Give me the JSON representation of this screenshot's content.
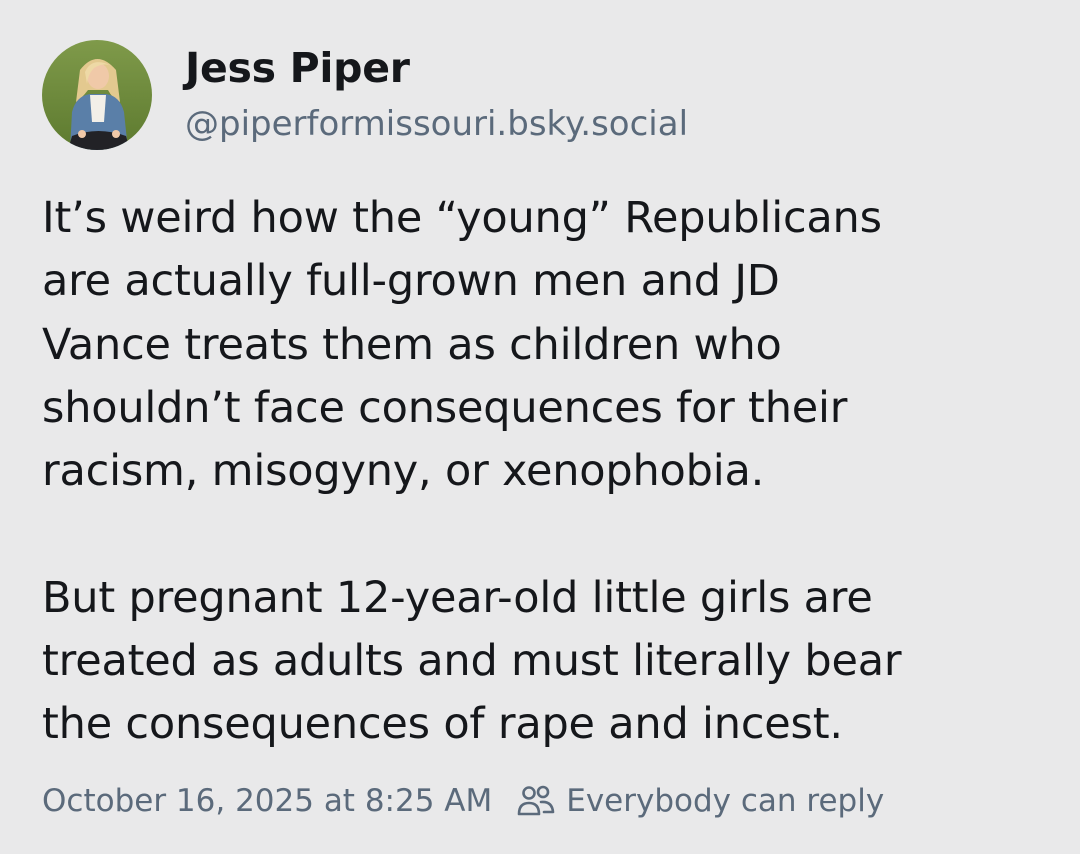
{
  "author": {
    "display_name": "Jess Piper",
    "handle": "@piperformissouri.bsky.social",
    "avatar_icon": "profile-photo"
  },
  "post": {
    "paragraphs": [
      "It’s weird how the “young” Republicans\nare actually full-grown men and JD\nVance treats them as children who\nshouldn’t face consequences for their\nracism, misogyny, or xenophobia.",
      "But pregnant 12-year-old little girls are\ntreated as adults and must literally bear\nthe consequences of rape and incest."
    ]
  },
  "meta": {
    "timestamp": "October 16, 2025 at 8:25 AM",
    "reply_icon": "people-icon",
    "reply_setting": "Everybody can reply"
  },
  "colors": {
    "background": "#e9e9ea",
    "text": "#15171b",
    "muted": "#5b6a7b"
  }
}
